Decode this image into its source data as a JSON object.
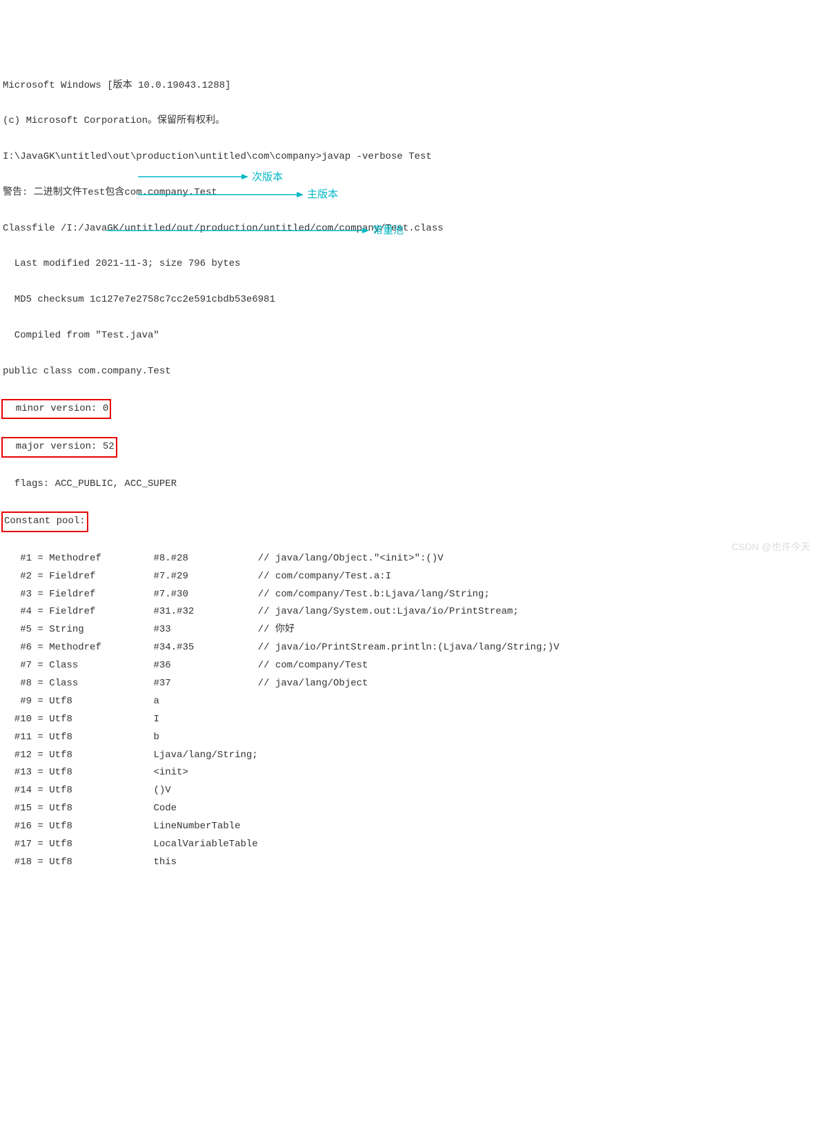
{
  "header": {
    "line1": "Microsoft Windows [版本 10.0.19043.1288]",
    "line2": "(c) Microsoft Corporation。保留所有权利。",
    "cmd": "I:\\JavaGK\\untitled\\out\\production\\untitled\\com\\company>javap -verbose Test",
    "warn": "警告: 二进制文件Test包含com.company.Test",
    "classfile": "Classfile /I:/JavaGK/untitled/out/production/untitled/com/company/Test.class",
    "lastmod": "  Last modified 2021-11-3; size 796 bytes",
    "md5": "  MD5 checksum 1c127e7e2758c7cc2e591cbdb53e6981",
    "compiled": "  Compiled from \"Test.java\"",
    "classdecl": "public class com.company.Test",
    "minor": "  minor version: 0",
    "major": "  major version: 52",
    "flags": "  flags: ACC_PUBLIC, ACC_SUPER",
    "constpool": "Constant pool:"
  },
  "annotations": {
    "minor": "次版本",
    "major": "主版本",
    "constpool": "常量池"
  },
  "pool": [
    {
      "idx": "#1",
      "type": "Methodref",
      "ref": "#8.#28",
      "comment": "// java/lang/Object.\"<init>\":()V"
    },
    {
      "idx": "#2",
      "type": "Fieldref",
      "ref": "#7.#29",
      "comment": "// com/company/Test.a:I"
    },
    {
      "idx": "#3",
      "type": "Fieldref",
      "ref": "#7.#30",
      "comment": "// com/company/Test.b:Ljava/lang/String;"
    },
    {
      "idx": "#4",
      "type": "Fieldref",
      "ref": "#31.#32",
      "comment": "// java/lang/System.out:Ljava/io/PrintStream;"
    },
    {
      "idx": "#5",
      "type": "String",
      "ref": "#33",
      "comment": "// 你好"
    },
    {
      "idx": "#6",
      "type": "Methodref",
      "ref": "#34.#35",
      "comment": "// java/io/PrintStream.println:(Ljava/lang/String;)V"
    },
    {
      "idx": "#7",
      "type": "Class",
      "ref": "#36",
      "comment": "// com/company/Test"
    },
    {
      "idx": "#8",
      "type": "Class",
      "ref": "#37",
      "comment": "// java/lang/Object"
    },
    {
      "idx": "#9",
      "type": "Utf8",
      "ref": "a",
      "comment": ""
    },
    {
      "idx": "#10",
      "type": "Utf8",
      "ref": "I",
      "comment": ""
    },
    {
      "idx": "#11",
      "type": "Utf8",
      "ref": "b",
      "comment": ""
    },
    {
      "idx": "#12",
      "type": "Utf8",
      "ref": "Ljava/lang/String;",
      "comment": ""
    },
    {
      "idx": "#13",
      "type": "Utf8",
      "ref": "<init>",
      "comment": ""
    },
    {
      "idx": "#14",
      "type": "Utf8",
      "ref": "()V",
      "comment": ""
    },
    {
      "idx": "#15",
      "type": "Utf8",
      "ref": "Code",
      "comment": ""
    },
    {
      "idx": "#16",
      "type": "Utf8",
      "ref": "LineNumberTable",
      "comment": ""
    },
    {
      "idx": "#17",
      "type": "Utf8",
      "ref": "LocalVariableTable",
      "comment": ""
    },
    {
      "idx": "#18",
      "type": "Utf8",
      "ref": "this",
      "comment": ""
    }
  ],
  "watermark": "CSDN @也许今天"
}
